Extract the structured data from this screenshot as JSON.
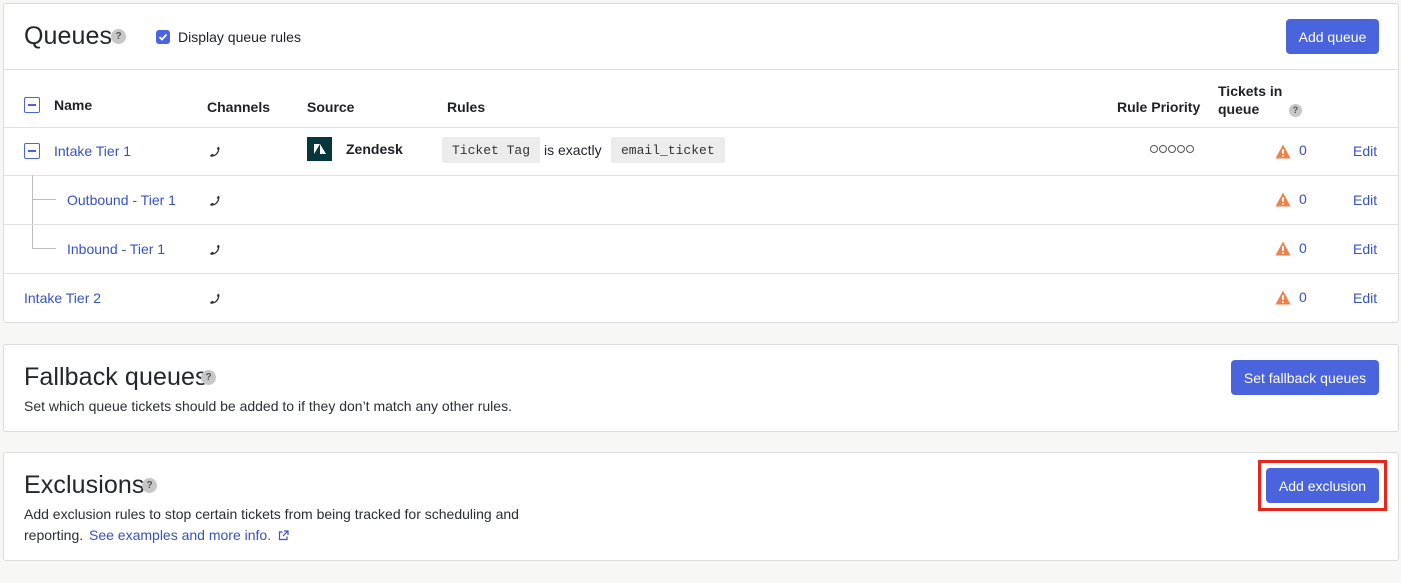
{
  "queues": {
    "title": "Queues",
    "display_rules_label": "Display queue rules",
    "add_button": "Add queue",
    "columns": {
      "name": "Name",
      "channels": "Channels",
      "source": "Source",
      "rules": "Rules",
      "rule_priority": "Rule Priority",
      "tickets_in_queue_1": "Tickets in",
      "tickets_in_queue_2": "queue"
    },
    "rows": [
      {
        "name": "Intake Tier 1",
        "source": "Zendesk",
        "rule_field": "Ticket Tag",
        "rule_op": "is exactly",
        "rule_value": "email_ticket",
        "count": "0",
        "edit": "Edit"
      },
      {
        "name": "Outbound - Tier 1",
        "count": "0",
        "edit": "Edit"
      },
      {
        "name": "Inbound - Tier 1",
        "count": "0",
        "edit": "Edit"
      },
      {
        "name": "Intake Tier 2",
        "count": "0",
        "edit": "Edit"
      }
    ]
  },
  "fallback": {
    "title": "Fallback queues",
    "description": "Set which queue tickets should be added to if they don’t match any other rules.",
    "button": "Set fallback queues"
  },
  "exclusions": {
    "title": "Exclusions",
    "description_line1": "Add exclusion rules to stop certain tickets from being tracked for scheduling and",
    "description_line2": "reporting.",
    "link": "See examples and more info.",
    "button": "Add exclusion"
  },
  "colors": {
    "accent": "#4a64de",
    "link": "#3652c9",
    "warning": "#f0804a",
    "highlight": "#e8251b"
  }
}
